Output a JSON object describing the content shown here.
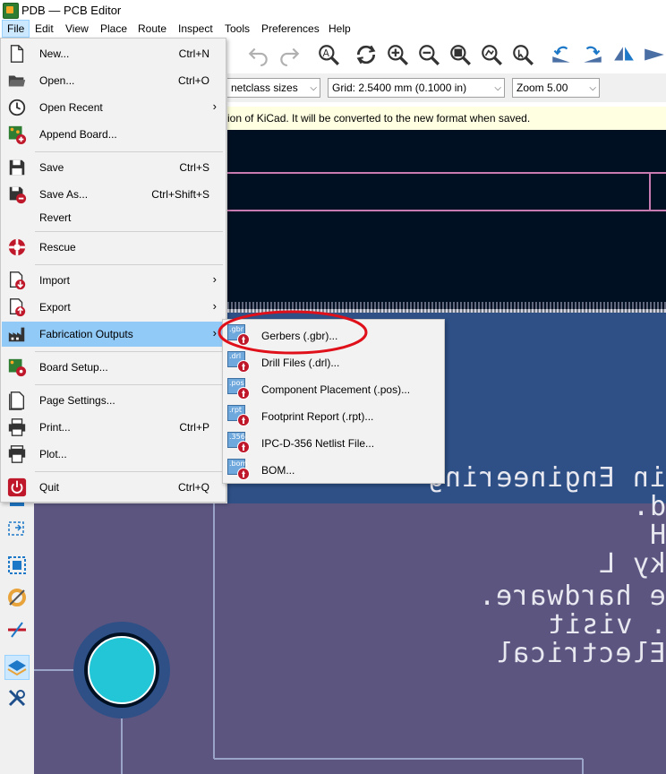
{
  "window": {
    "title": "PDB — PCB Editor"
  },
  "menubar": [
    "File",
    "Edit",
    "View",
    "Place",
    "Route",
    "Inspect",
    "Tools",
    "Preferences",
    "Help"
  ],
  "toolbar2": {
    "netclass": "netclass sizes",
    "grid": "Grid: 2.5400 mm (0.1000 in)",
    "zoom": "Zoom 5.00"
  },
  "infobar": {
    "text": "ion of KiCad. It will be converted to the new format when saved."
  },
  "file_menu": {
    "new": {
      "label": "New...",
      "shortcut": "Ctrl+N"
    },
    "open": {
      "label": "Open...",
      "shortcut": "Ctrl+O"
    },
    "open_recent": {
      "label": "Open Recent"
    },
    "append_board": {
      "label": "Append Board..."
    },
    "save": {
      "label": "Save",
      "shortcut": "Ctrl+S"
    },
    "save_as": {
      "label": "Save As...",
      "shortcut": "Ctrl+Shift+S"
    },
    "revert": {
      "label": "Revert"
    },
    "rescue": {
      "label": "Rescue"
    },
    "import": {
      "label": "Import"
    },
    "export": {
      "label": "Export"
    },
    "fabrication_outputs": {
      "label": "Fabrication Outputs"
    },
    "board_setup": {
      "label": "Board Setup..."
    },
    "page_settings": {
      "label": "Page Settings..."
    },
    "print": {
      "label": "Print...",
      "shortcut": "Ctrl+P"
    },
    "plot": {
      "label": "Plot..."
    },
    "quit": {
      "label": "Quit",
      "shortcut": "Ctrl+Q"
    }
  },
  "fabrication_submenu": [
    {
      "label": "Gerbers (.gbr)...",
      "ext": ".gbr"
    },
    {
      "label": "Drill Files (.drl)...",
      "ext": ".drl"
    },
    {
      "label": "Component Placement (.pos)...",
      "ext": ".pos"
    },
    {
      "label": "Footprint Report (.rpt)...",
      "ext": ".rpt"
    },
    {
      "label": "IPC-D-356 Netlist File...",
      "ext": ".356"
    },
    {
      "label": "BOM...",
      "ext": ".bom"
    }
  ],
  "canvas_silkscreen": [
    "in Engineering",
    "d.",
    "H",
    "ky L",
    "e hardware.",
    ". visit",
    "Electrical"
  ],
  "colors": {
    "canvas_dark": "#001023",
    "canvas_blue": "#2e5086",
    "canvas_purple": "#5b5580",
    "menu_highlight": "#91c9f7",
    "annotation_red": "#e0101a"
  }
}
